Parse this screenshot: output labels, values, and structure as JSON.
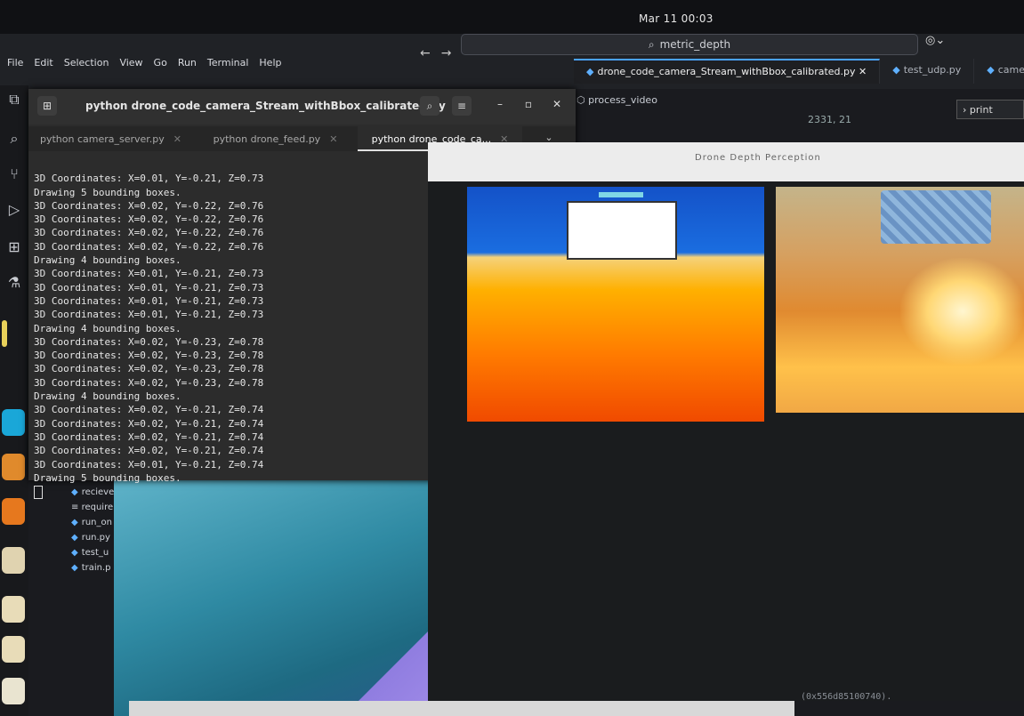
{
  "clock": "Mar 11  00:03",
  "menu": {
    "items": [
      "File",
      "Edit",
      "Selection",
      "View",
      "Go",
      "Run",
      "Terminal",
      "Help"
    ]
  },
  "search": {
    "text": "metric_depth"
  },
  "editor_tabs": [
    "drone_code_camera_Stream_withBbox_calibrated.py",
    "test_udp.py",
    "camera_s"
  ],
  "breadcrumb": "process_video",
  "print_box": "print",
  "coord_fragment": "2331, 21",
  "terminal": {
    "title": "python drone_code_camera_Stream_withBbox_calibrated.py",
    "tabs": [
      "python camera_server.py",
      "python drone_feed.py",
      "python drone_code_ca..."
    ],
    "lines": [
      "3D Coordinates: X=0.01, Y=-0.21, Z=0.73",
      "Drawing 5 bounding boxes.",
      "3D Coordinates: X=0.02, Y=-0.22, Z=0.76",
      "3D Coordinates: X=0.02, Y=-0.22, Z=0.76",
      "3D Coordinates: X=0.02, Y=-0.22, Z=0.76",
      "3D Coordinates: X=0.02, Y=-0.22, Z=0.76",
      "Drawing 4 bounding boxes.",
      "3D Coordinates: X=0.01, Y=-0.21, Z=0.73",
      "3D Coordinates: X=0.01, Y=-0.21, Z=0.73",
      "3D Coordinates: X=0.01, Y=-0.21, Z=0.73",
      "3D Coordinates: X=0.01, Y=-0.21, Z=0.73",
      "Drawing 4 bounding boxes.",
      "3D Coordinates: X=0.02, Y=-0.23, Z=0.78",
      "3D Coordinates: X=0.02, Y=-0.23, Z=0.78",
      "3D Coordinates: X=0.02, Y=-0.23, Z=0.78",
      "3D Coordinates: X=0.02, Y=-0.23, Z=0.78",
      "Drawing 4 bounding boxes.",
      "3D Coordinates: X=0.02, Y=-0.21, Z=0.74",
      "3D Coordinates: X=0.02, Y=-0.21, Z=0.74",
      "3D Coordinates: X=0.02, Y=-0.21, Z=0.74",
      "3D Coordinates: X=0.02, Y=-0.21, Z=0.74",
      "3D Coordinates: X=0.01, Y=-0.21, Z=0.74",
      "Drawing 5 bounding boxes."
    ]
  },
  "explorer_files": [
    "recieve",
    "require",
    "run_on",
    "run.py",
    "test_u",
    "train.p"
  ],
  "depth_window": {
    "title": "Drone Depth Perception"
  },
  "bottom_fragment": "(0x556d85100740)."
}
